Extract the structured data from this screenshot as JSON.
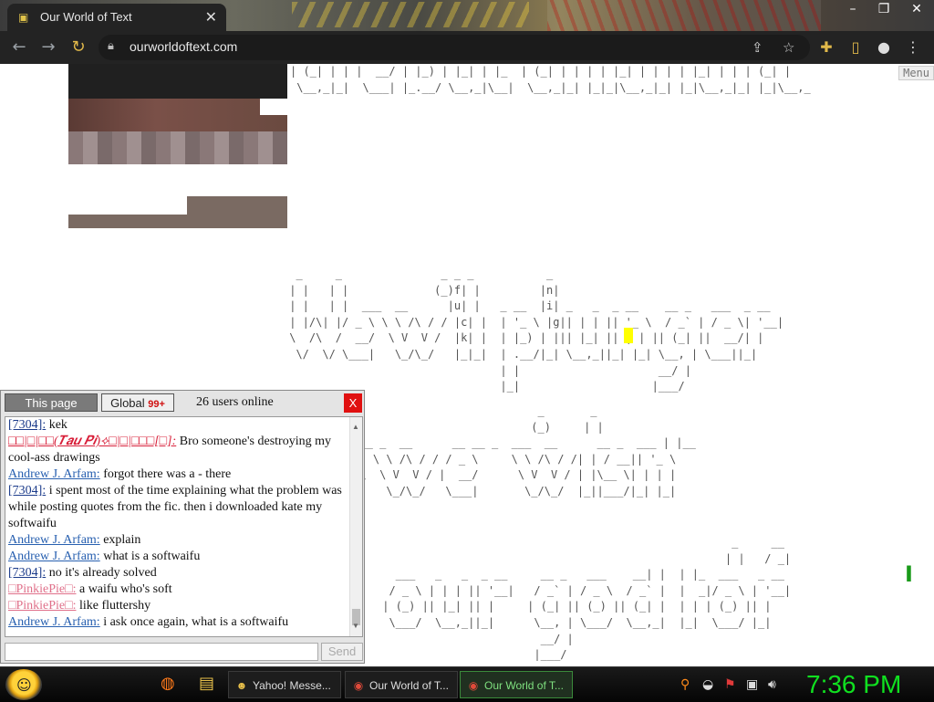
{
  "browser": {
    "tab_title": "Our World of Text",
    "url": "ourworldoftext.com",
    "tab_close": "✕",
    "window_buttons": [
      "–",
      "❐",
      "✕"
    ]
  },
  "page": {
    "menu_label": "Menu",
    "ascii_top": "| (_| | | |  __/ | |_) | |_| | |_  | (_| | | | | |_| | | | | |_| | | | (_| |\n \\__,_|_|  \\___| |_.__/ \\__,_|\\__|  \\__,_|_| |_|_|\\__,_|_| |_|\\__,_|_| |_|\\__,_",
    "ascii_block1": "  _     _               _ _ _           _\n | |   | |             (_)f| |         |n|\n | |   | |  ___  __      |u| |   _ __  |i| _   _  _ __    __ _   ___  _ __\n | |/\\| |/ _ \\ \\ \\ /\\ / / |c| |  | '_ \\ |g|| | | || '_ \\  / _` | / _ \\| '__|\n \\  /\\  /  __/  \\ V  V /  |k| |  | |_) | ||| |_| || | | || (_| ||  __/| |\n  \\/  \\/ \\___|   \\_/\\_/   |_|_|  | .__/|_| \\__,_||_| |_| \\__, | \\___||_|\n                                 | |                     __/ |\n                                 |_|                    |___/",
    "ascii_block2": "                             _       _\n                            (_)     | |\n  __ _  __      __ __ _  ___  __      __ _  ___ | |__\n _| \\ \\ /\\ / / / _ \\     \\ \\ /\\ / /| | / __|| '_ \\\n  \\  \\ V  V / |  __/      \\ V  V / | |\\__ \\| | | |\n_/    \\_/\\_/   \\___|       \\_/\\_/  |_||___/|_| |_|",
    "ascii_block3": "                                                      _     __\n                                                     | |   / _|\n   ___   _   _  _ __     __ _   ___    __| |  | |_  ___   _ __\n  / _ \\ | | | || '__|   / _` | / _ \\  / _` |  |  _|/ _ \\ | '__|\n | (_) || |_| || |     | (_| || (_) || (_| |  | | | (_) || |\n  \\___/  \\__,_||_|      \\__, | \\___/  \\__,_|  |_|  \\___/ |_|\n                         __/ |\n                        |___/"
  },
  "chat": {
    "tab_this_page": "This page",
    "tab_global": "Global",
    "global_badge": "99+",
    "users_online": "26 users online",
    "close_label": "X",
    "send_label": "Send",
    "input_value": "",
    "messages": [
      {
        "user": "[7304]:",
        "style": "num",
        "text": " kek"
      },
      {
        "user": "□□|□|□□(𝑻𝒂𝒖 𝑷𝒊)⟡□|□|□□□[□]:",
        "style": "red",
        "text": " Bro someone's destroying my cool-ass drawings"
      },
      {
        "user": "Andrew J. Arfam:",
        "style": "blue",
        "text": " forgot there was a - there"
      },
      {
        "user": "[7304]:",
        "style": "num",
        "text": " i spent most of the time explaining what the problem was while posting quotes from the fic. then i downloaded kate my softwaifu"
      },
      {
        "user": "Andrew J. Arfam:",
        "style": "blue",
        "text": " explain"
      },
      {
        "user": "Andrew J. Arfam:",
        "style": "blue",
        "text": " what is a softwaifu"
      },
      {
        "user": "[7304]:",
        "style": "num",
        "text": " no it's already solved"
      },
      {
        "user": "□PinkiePie□:",
        "style": "pink",
        "text": " a waifu who's soft"
      },
      {
        "user": "□PinkiePie□:",
        "style": "pink",
        "text": " like fluttershy"
      },
      {
        "user": "Andrew J. Arfam:",
        "style": "blue",
        "text": " i ask once again, what is a softwaifu"
      }
    ]
  },
  "taskbar": {
    "buttons": [
      {
        "label": "Yahoo! Messe...",
        "icon": "☻"
      },
      {
        "label": "Our World of T...",
        "icon": "◉"
      },
      {
        "label": "Our World of T...",
        "icon": "◉"
      }
    ],
    "clock": "7:36 PM"
  },
  "colors": {
    "chat_close": "#e01010",
    "clock": "#10e020",
    "cursor_highlight": "#ffff00"
  }
}
